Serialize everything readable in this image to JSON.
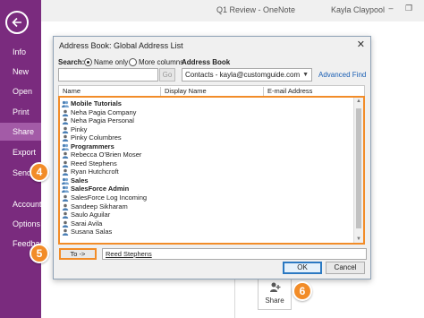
{
  "app": {
    "title": "Q1 Review - OneNote",
    "user": "Kayla Claypool"
  },
  "sidebar": {
    "items": [
      {
        "label": "Info"
      },
      {
        "label": "New"
      },
      {
        "label": "Open"
      },
      {
        "label": "Print"
      },
      {
        "label": "Share",
        "active": true
      },
      {
        "label": "Export"
      },
      {
        "label": "Send"
      },
      {
        "label": "Account"
      },
      {
        "label": "Options"
      },
      {
        "label": "Feedback"
      }
    ]
  },
  "background": {
    "share_tile_label": "Share"
  },
  "dialog": {
    "title": "Address Book: Global Address List",
    "search_label": "Search:",
    "name_only_label": "Name only",
    "more_columns_label": "More columns",
    "address_book_label": "Address Book",
    "search_value": "",
    "go_label": "Go",
    "address_book_value": "Contacts - kayla@customguide.com",
    "advanced_find_label": "Advanced Find",
    "columns": [
      "Name",
      "Display Name",
      "E-mail Address"
    ],
    "rows": [
      {
        "name": "Mobile Tutorials",
        "type": "group"
      },
      {
        "name": "Neha Pagia Company",
        "type": "contact"
      },
      {
        "name": "Neha Pagia Personal",
        "type": "contact"
      },
      {
        "name": "Pinky",
        "type": "contact"
      },
      {
        "name": "Pinky Columbres",
        "type": "contact"
      },
      {
        "name": "Programmers",
        "type": "group"
      },
      {
        "name": "Rebecca O'Brien Moser",
        "type": "contact"
      },
      {
        "name": "Reed Stephens",
        "type": "contact"
      },
      {
        "name": "Ryan Hutchcroft",
        "type": "contact"
      },
      {
        "name": "Sales",
        "type": "group"
      },
      {
        "name": "SalesForce Admin",
        "type": "group"
      },
      {
        "name": "SalesForce Log Incoming",
        "type": "contact"
      },
      {
        "name": "Sandeep Sikharam",
        "type": "contact"
      },
      {
        "name": "Saulo Aguilar",
        "type": "contact"
      },
      {
        "name": "Sarai Avila",
        "type": "contact"
      },
      {
        "name": "Susana Salas",
        "type": "contact"
      }
    ],
    "to_button_label": "To ->",
    "to_value": "Reed Stephens",
    "ok_label": "OK",
    "cancel_label": "Cancel"
  },
  "callouts": [
    "4",
    "5",
    "6"
  ],
  "colors": {
    "sidebar": "#7a2b7e",
    "sidebar_active": "#a35ba7",
    "callout": "#f28c28",
    "link": "#1a5fb4",
    "ok_border": "#2b79c2"
  }
}
